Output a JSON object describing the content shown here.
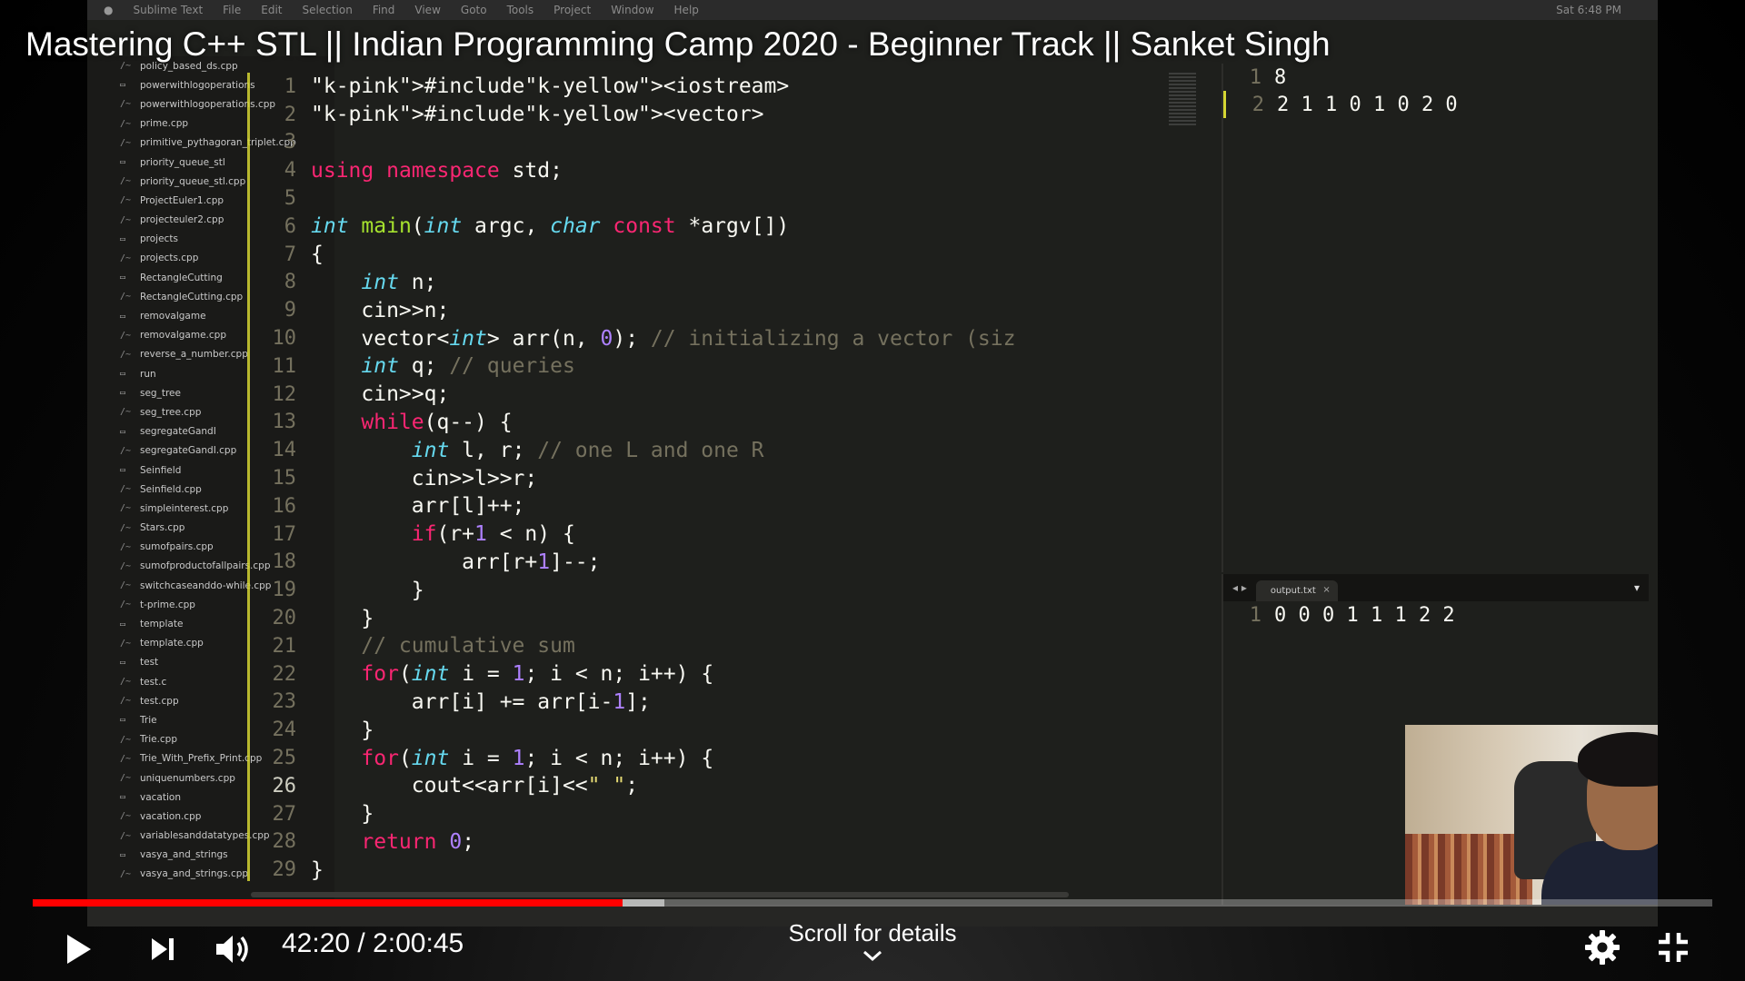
{
  "video": {
    "title": "Mastering C++ STL || Indian Programming Camp 2020 - Beginner Track || Sanket Singh",
    "time_current": "42:20",
    "time_separator": " / ",
    "time_total": "2:00:45",
    "played_fraction": 0.351,
    "buffered_fraction": 0.376,
    "scroll_hint": "Scroll for details"
  },
  "menubar": {
    "items": [
      "Sublime Text",
      "File",
      "Edit",
      "Selection",
      "Find",
      "View",
      "Goto",
      "Tools",
      "Project",
      "Window",
      "Help"
    ],
    "clock": "Sat 6:48 PM"
  },
  "sidebar": {
    "files": [
      {
        "name": "policy_based_ds.cpp",
        "folder": false
      },
      {
        "name": "powerwithlogoperations",
        "folder": true
      },
      {
        "name": "powerwithlogoperations.cpp",
        "folder": false
      },
      {
        "name": "prime.cpp",
        "folder": false
      },
      {
        "name": "primitive_pythagoran_triplet.cpp",
        "folder": false
      },
      {
        "name": "priority_queue_stl",
        "folder": true
      },
      {
        "name": "priority_queue_stl.cpp",
        "folder": false
      },
      {
        "name": "ProjectEuler1.cpp",
        "folder": false
      },
      {
        "name": "projecteuler2.cpp",
        "folder": false
      },
      {
        "name": "projects",
        "folder": true
      },
      {
        "name": "projects.cpp",
        "folder": false
      },
      {
        "name": "RectangleCutting",
        "folder": true
      },
      {
        "name": "RectangleCutting.cpp",
        "folder": false
      },
      {
        "name": "removalgame",
        "folder": true
      },
      {
        "name": "removalgame.cpp",
        "folder": false
      },
      {
        "name": "reverse_a_number.cpp",
        "folder": false
      },
      {
        "name": "run",
        "folder": true
      },
      {
        "name": "seg_tree",
        "folder": true
      },
      {
        "name": "seg_tree.cpp",
        "folder": false
      },
      {
        "name": "segregateGandI",
        "folder": true
      },
      {
        "name": "segregateGandI.cpp",
        "folder": false
      },
      {
        "name": "Seinfield",
        "folder": true
      },
      {
        "name": "Seinfield.cpp",
        "folder": false
      },
      {
        "name": "simpleinterest.cpp",
        "folder": false
      },
      {
        "name": "Stars.cpp",
        "folder": false
      },
      {
        "name": "sumofpairs.cpp",
        "folder": false
      },
      {
        "name": "sumofproductofallpairs.cpp",
        "folder": false
      },
      {
        "name": "switchcaseanddo-while.cpp",
        "folder": false
      },
      {
        "name": "t-prime.cpp",
        "folder": false
      },
      {
        "name": "template",
        "folder": true
      },
      {
        "name": "template.cpp",
        "folder": false
      },
      {
        "name": "test",
        "folder": true
      },
      {
        "name": "test.c",
        "folder": false
      },
      {
        "name": "test.cpp",
        "folder": false
      },
      {
        "name": "Trie",
        "folder": true
      },
      {
        "name": "Trie.cpp",
        "folder": false
      },
      {
        "name": "Trie_With_Prefix_Print.cpp",
        "folder": false
      },
      {
        "name": "uniquenumbers.cpp",
        "folder": false
      },
      {
        "name": "vacation",
        "folder": true
      },
      {
        "name": "vacation.cpp",
        "folder": false
      },
      {
        "name": "variablesanddatatypes.cpp",
        "folder": false
      },
      {
        "name": "vasya_and_strings",
        "folder": true
      },
      {
        "name": "vasya_and_strings.cpp",
        "folder": false
      }
    ]
  },
  "editor": {
    "lines": [
      "#include<iostream>",
      "#include<vector>",
      "",
      "using namespace std;",
      "",
      "int main(int argc, char const *argv[])",
      "{",
      "    int n;",
      "    cin>>n;",
      "    vector<int> arr(n, 0); // initializing a vector (siz",
      "    int q; // queries",
      "    cin>>q;",
      "    while(q--) {",
      "        int l, r; // one L and one R",
      "        cin>>l>>r;",
      "        arr[l]++;",
      "        if(r+1 < n) {",
      "            arr[r+1]--;",
      "        }",
      "    }",
      "    // cumulative sum",
      "    for(int i = 1; i < n; i++) {",
      "        arr[i] += arr[i-1];",
      "    }",
      "    for(int i = 1; i < n; i++) {",
      "        cout<<arr[i]<<\" \";",
      "    }",
      "    return 0;",
      "}"
    ],
    "active_line": 26
  },
  "input_pane": {
    "lines": [
      "8",
      "2 1 1 0 1 0 2 0"
    ]
  },
  "output_pane": {
    "tab": "output.txt",
    "lines": [
      "0 0 0 1 1 1 2 2"
    ]
  },
  "icons": {
    "play": "play-icon",
    "next": "next-icon",
    "volume": "volume-icon",
    "settings": "gear-icon",
    "exit_fullscreen": "exit-fullscreen-icon",
    "chevron": "chevron-down-icon"
  },
  "colors": {
    "progress_played": "#ff0000",
    "accent_yellow": "#d6d633"
  }
}
